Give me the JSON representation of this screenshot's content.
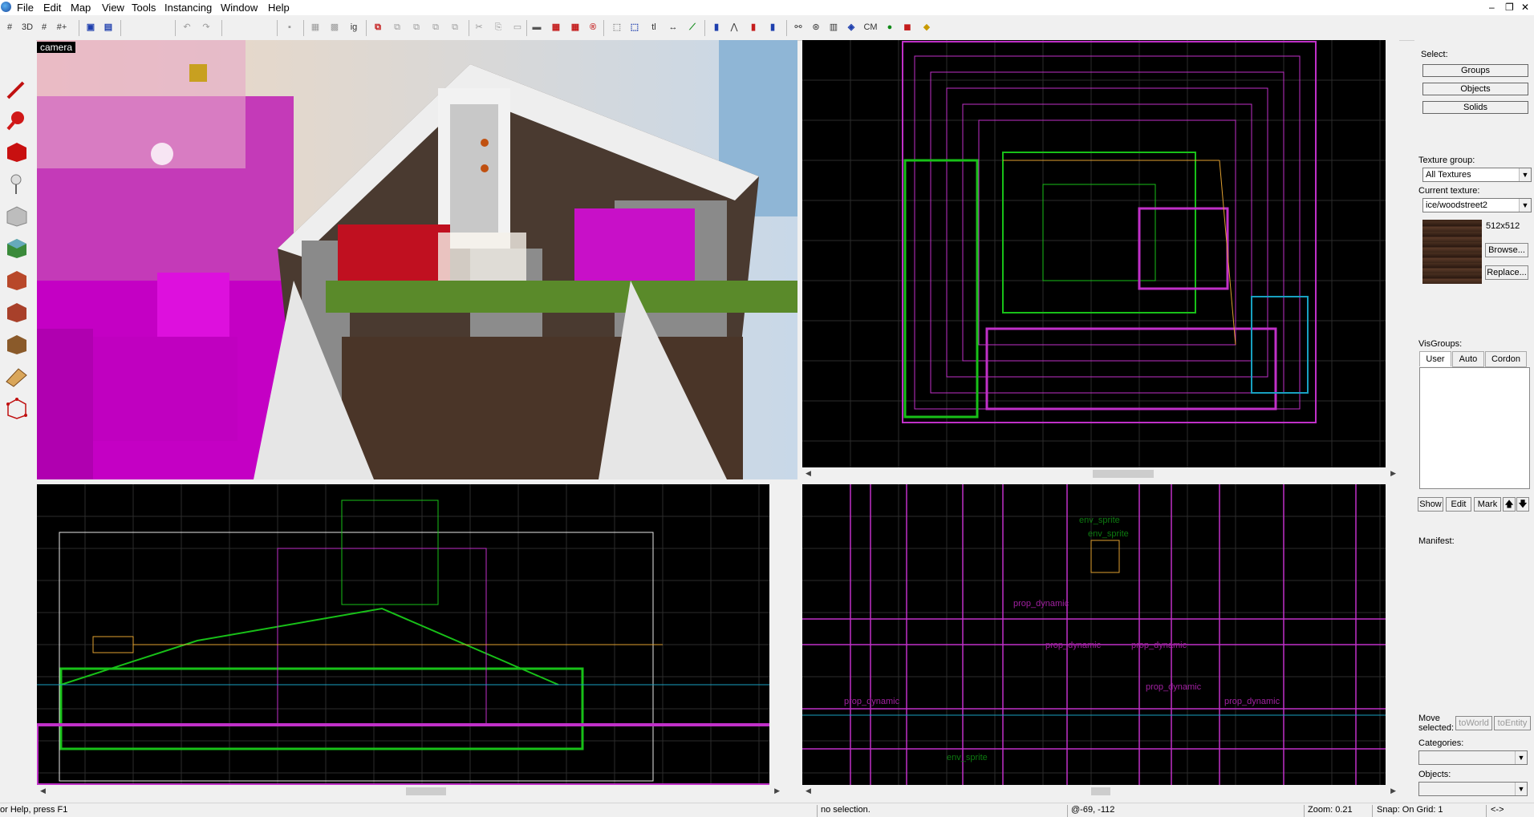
{
  "app": {
    "logo_icon": "hammer-globe-icon"
  },
  "menu": [
    {
      "label": "File"
    },
    {
      "label": "Edit"
    },
    {
      "label": "Map"
    },
    {
      "label": "View"
    },
    {
      "label": "Tools"
    },
    {
      "label": "Instancing"
    },
    {
      "label": "Window"
    },
    {
      "label": "Help"
    }
  ],
  "window_controls": {
    "minimize": "–",
    "restore": "❐",
    "close": "✕"
  },
  "toolbar": {
    "grid_icons": [
      "#",
      "3D",
      "#",
      "#+",
      "≋",
      "⌗"
    ],
    "cm_label": "CM"
  },
  "viewports": {
    "camera": {
      "label": "camera"
    },
    "side": {
      "labels": [
        {
          "text": "env_sprite",
          "color": "#0d7a10"
        },
        {
          "text": "env_sprite",
          "color": "#0d7a10"
        },
        {
          "text": "prop_dynamic",
          "color": "#a020a0"
        },
        {
          "text": "prop_dynamic",
          "color": "#a020a0"
        },
        {
          "text": "prop_dynamic",
          "color": "#a020a0"
        },
        {
          "text": "prop_dynamic",
          "color": "#a020a0"
        },
        {
          "text": "prop_dynamic",
          "color": "#a020a0"
        },
        {
          "text": "prop_dynamic",
          "color": "#a020a0"
        },
        {
          "text": "env_sprite",
          "color": "#0d7a10"
        }
      ]
    }
  },
  "panel": {
    "select_label": "Select:",
    "groups_btn": "Groups",
    "objects_btn": "Objects",
    "solids_btn": "Solids",
    "texture_group_label": "Texture group:",
    "texture_group_value": "All Textures",
    "current_texture_label": "Current texture:",
    "current_texture_value": "ice/woodstreet2",
    "texture_size": "512x512",
    "browse_btn": "Browse...",
    "replace_btn": "Replace...",
    "visgroups_label": "VisGroups:",
    "tabs": [
      "User",
      "Auto",
      "Cordon"
    ],
    "show_btn": "Show",
    "edit_btn": "Edit",
    "mark_btn": "Mark",
    "up_btn": "🡅",
    "down_btn": "🡇",
    "manifest_label": "Manifest:",
    "move_selected_label": "Move selected:",
    "to_world_btn": "toWorld",
    "to_entity_btn": "toEntity",
    "categories_label": "Categories:",
    "objects_label": "Objects:"
  },
  "status": {
    "help": "or Help, press F1",
    "selection": "no selection.",
    "coords": "@-69, -112",
    "zoom": "Zoom: 0.21",
    "snap": "Snap: On Grid: 1",
    "extra": "<->"
  },
  "colors": {
    "magenta": "#c030c8",
    "green": "#18c018",
    "grid": "#3a3a3a",
    "viewport_bg": "#000000"
  }
}
